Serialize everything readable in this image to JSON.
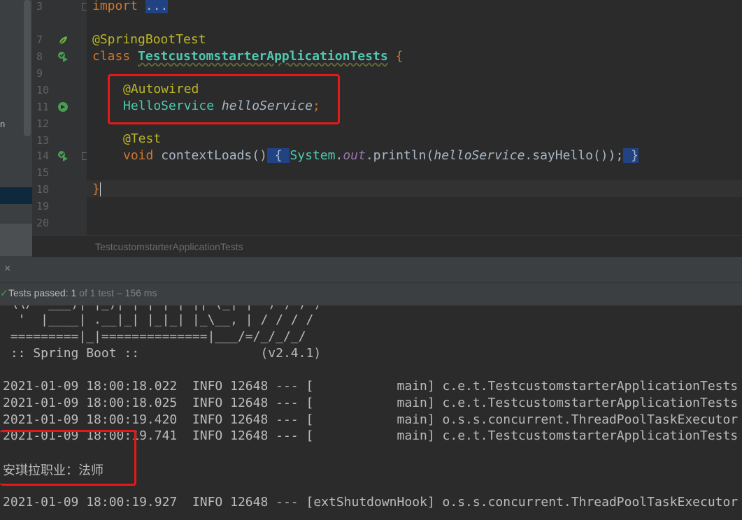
{
  "editor": {
    "lines": [
      {
        "num": "3",
        "top": 0
      },
      {
        "num": "7",
        "top": 0
      },
      {
        "num": "8",
        "top": 0
      },
      {
        "num": "9",
        "top": 0
      },
      {
        "num": "10",
        "top": 0
      },
      {
        "num": "11",
        "top": 0
      },
      {
        "num": "12",
        "top": 0
      },
      {
        "num": "13",
        "top": 0
      },
      {
        "num": "14",
        "top": 0
      },
      {
        "num": "15",
        "top": 0
      },
      {
        "num": "18",
        "top": 0
      },
      {
        "num": "19",
        "top": 0
      },
      {
        "num": "20",
        "top": 0
      }
    ],
    "code": {
      "import_kw": "import",
      "import_fold": "...",
      "annotation_sbt": "@SpringBootTest",
      "class_kw": "class",
      "class_name": "TestcustomstarterApplicationTests",
      "brace_open": "{",
      "annotation_autowired": "@Autowired",
      "field_type": "HelloService",
      "field_name": "helloService",
      "semicolon": ";",
      "annotation_test": "@Test",
      "void_kw": "void",
      "method_name": "contextLoads()",
      "inline_open": " { ",
      "system": "System",
      "dot1": ".",
      "out": "out",
      "println": ".println(",
      "hello_ref": "helloService",
      "say_hello": ".sayHello());",
      "inline_close": " }",
      "brace_close": "}"
    }
  },
  "breadcrumb": "TestcustomstarterApplicationTests",
  "run_panel": {
    "close_glyph": "×",
    "tests_passed_label": "Tests passed: ",
    "tests_passed_count": "1",
    "tests_passed_rest": " of 1 test – 156 ms"
  },
  "console": {
    "lines": [
      " \\\\/  ___)| |_)| | | | | || (_| |  ) ) ) )",
      "  '  |____| .__|_| |_|_| |_\\__, | / / / /",
      " =========|_|==============|___/=/_/_/_/",
      " :: Spring Boot ::                (v2.4.1)",
      "",
      "2021-01-09 18:00:18.022  INFO 12648 --- [           main] c.e.t.TestcustomstarterApplicationTests",
      "2021-01-09 18:00:18.025  INFO 12648 --- [           main] c.e.t.TestcustomstarterApplicationTests",
      "2021-01-09 18:00:19.420  INFO 12648 --- [           main] o.s.s.concurrent.ThreadPoolTaskExecutor",
      "2021-01-09 18:00:19.741  INFO 12648 --- [           main] c.e.t.TestcustomstarterApplicationTests",
      "",
      "安琪拉职业：法师",
      "",
      "2021-01-09 18:00:19.927  INFO 12648 --- [extShutdownHook] o.s.s.concurrent.ThreadPoolTaskExecutor"
    ]
  },
  "colors": {
    "keyword": "#cc7832",
    "annotation": "#bbb529",
    "class": "#4ec9b0",
    "highlight_box": "#e81818",
    "test_pass": "#499c54"
  },
  "left_strip_letter": "n"
}
